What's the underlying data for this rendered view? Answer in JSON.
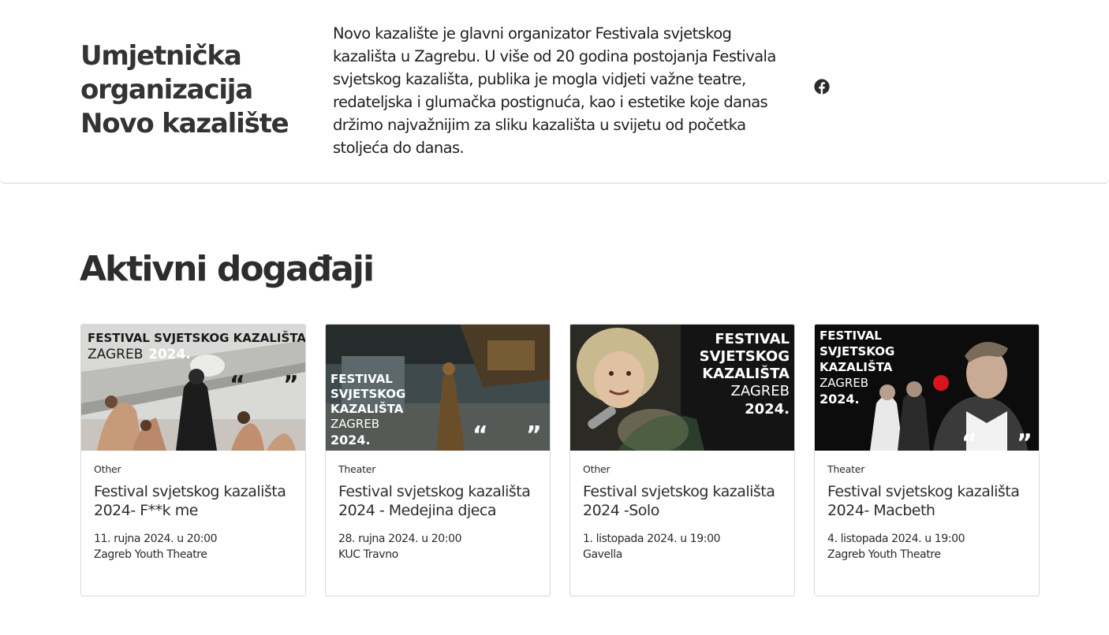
{
  "organization": {
    "name_lines": [
      "Umjetnička",
      "organizacija",
      "Novo kazalište"
    ],
    "description": "Novo kazalište je glavni organizator Festivala svjetskog kazališta u Zagrebu. U više od 20 godina postojanja Festivala svjetskog kazališta, publika je mogla vidjeti važne teatre, redateljska i glumačka postignuća, kao i estetike koje danas držimo najvažnijim za sliku kazališta u svijetu od početka stoljeća do danas.",
    "social_icon": "facebook-icon"
  },
  "events_section": {
    "title": "Aktivni događaji",
    "events": [
      {
        "category": "Other",
        "title": "Festival svjetskog kazališta 2024- F**k me",
        "date": "11. rujna 2024. u 20:00",
        "venue": "Zagreb Youth Theatre",
        "poster": {
          "festival_lines": [
            "FESTIVAL SVJETSKOG KAZALIŠTA"
          ],
          "city": "ZAGREB",
          "year": "2024."
        }
      },
      {
        "category": "Theater",
        "title": "Festival svjetskog kazališta 2024 - Medejina djeca",
        "date": "28. rujna 2024. u 20:00",
        "venue": "KUC Travno",
        "poster": {
          "festival_lines": [
            "FESTIVAL",
            "SVJETSKOG",
            "KAZALIŠTA"
          ],
          "city": "ZAGREB",
          "year": "2024."
        }
      },
      {
        "category": "Other",
        "title": "Festival svjetskog kazališta 2024 -Solo",
        "date": "1. listopada 2024. u 19:00",
        "venue": "Gavella",
        "poster": {
          "festival_lines": [
            "FESTIVAL",
            "SVJETSKOG",
            "KAZALIŠTA"
          ],
          "city": "ZAGREB",
          "year": "2024."
        }
      },
      {
        "category": "Theater",
        "title": "Festival svjetskog kazališta 2024- Macbeth",
        "date": "4. listopada 2024. u 19:00",
        "venue": "Zagreb Youth Theatre",
        "poster": {
          "festival_lines": [
            "FESTIVAL",
            "SVJETSKOG",
            "KAZALIŠTA"
          ],
          "city": "ZAGREB",
          "year": "2024."
        }
      }
    ]
  },
  "colors": {
    "text_dark": "#2d2d2d",
    "border": "#d9d9d9",
    "poster_dark": "#1a1a1a",
    "clown_nose": "#d8141c"
  }
}
